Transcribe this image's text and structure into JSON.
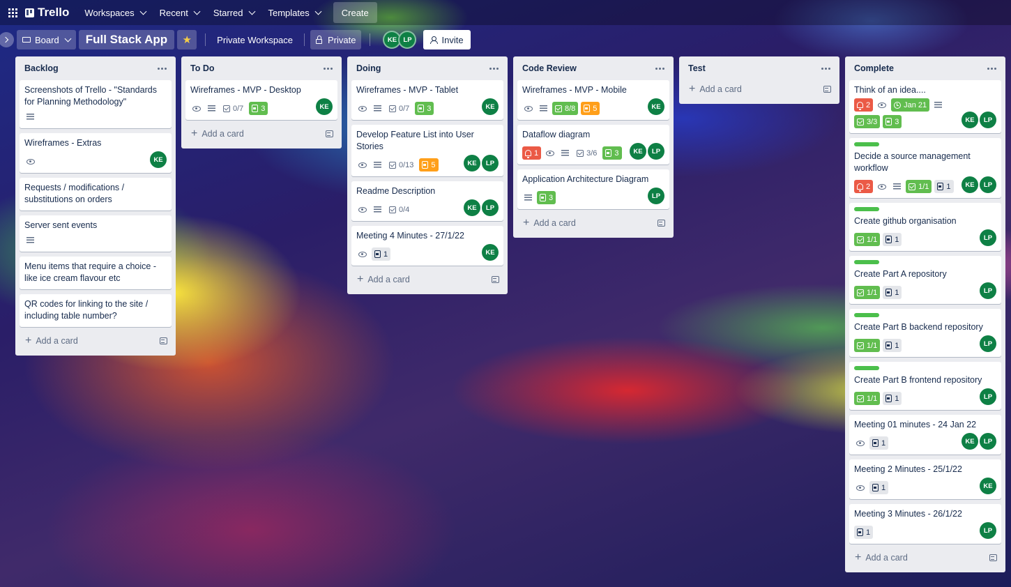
{
  "topbar": {
    "logo": "Trello",
    "nav": [
      {
        "label": "Workspaces"
      },
      {
        "label": "Recent"
      },
      {
        "label": "Starred"
      },
      {
        "label": "Templates"
      }
    ],
    "create": "Create"
  },
  "boardbar": {
    "view": "Board",
    "title": "Full Stack App",
    "workspace": "Private Workspace",
    "visibility": "Private",
    "members": [
      "KE",
      "LP"
    ],
    "invite": "Invite"
  },
  "add_card_label": "Add a card",
  "lists": [
    {
      "title": "Backlog",
      "cards": [
        {
          "title": "Screenshots of Trello - \"Standards for Planning Methodology\"",
          "badges": [
            {
              "type": "desc"
            }
          ],
          "members": []
        },
        {
          "title": "Wireframes - Extras",
          "badges": [
            {
              "type": "watch"
            }
          ],
          "members": [
            "KE"
          ]
        },
        {
          "title": "Requests / modifications / substitutions on orders",
          "badges": [],
          "members": []
        },
        {
          "title": "Server sent events",
          "badges": [
            {
              "type": "desc"
            }
          ],
          "members": []
        },
        {
          "title": "Menu items that require a choice - like ice cream flavour etc",
          "badges": [],
          "members": []
        },
        {
          "title": "QR codes for linking to the site / including table number?",
          "badges": [],
          "members": []
        }
      ]
    },
    {
      "title": "To Do",
      "cards": [
        {
          "title": "Wireframes - MVP - Desktop",
          "badges": [
            {
              "type": "watch"
            },
            {
              "type": "desc"
            },
            {
              "type": "check",
              "text": "0/7"
            },
            {
              "type": "sticker",
              "color": "green",
              "text": "3"
            }
          ],
          "members": [
            "KE"
          ]
        }
      ]
    },
    {
      "title": "Doing",
      "cards": [
        {
          "title": "Wireframes - MVP - Tablet",
          "badges": [
            {
              "type": "watch"
            },
            {
              "type": "desc"
            },
            {
              "type": "check",
              "text": "0/7"
            },
            {
              "type": "sticker",
              "color": "green",
              "text": "3"
            }
          ],
          "members": [
            "KE"
          ]
        },
        {
          "title": "Develop Feature List into User Stories",
          "badges": [
            {
              "type": "watch"
            },
            {
              "type": "desc"
            },
            {
              "type": "check",
              "text": "0/13"
            },
            {
              "type": "sticker",
              "color": "orange",
              "text": "5"
            }
          ],
          "members": [
            "KE",
            "LP"
          ]
        },
        {
          "title": "Readme Description",
          "badges": [
            {
              "type": "watch"
            },
            {
              "type": "desc"
            },
            {
              "type": "check",
              "text": "0/4"
            }
          ],
          "members": [
            "KE",
            "LP"
          ]
        },
        {
          "title": "Meeting 4 Minutes - 27/1/22",
          "badges": [
            {
              "type": "watch"
            },
            {
              "type": "sticker",
              "color": "grey",
              "text": "1"
            }
          ],
          "members": [
            "KE"
          ]
        }
      ]
    },
    {
      "title": "Code Review",
      "cards": [
        {
          "title": "Wireframes - MVP - Mobile",
          "badges": [
            {
              "type": "watch"
            },
            {
              "type": "desc"
            },
            {
              "type": "check",
              "color": "green",
              "text": "8/8"
            },
            {
              "type": "sticker",
              "color": "orange",
              "text": "5"
            }
          ],
          "members": [
            "KE"
          ]
        },
        {
          "title": "Dataflow diagram",
          "badges": [
            {
              "type": "bell",
              "color": "red",
              "text": "1"
            },
            {
              "type": "watch"
            },
            {
              "type": "desc"
            },
            {
              "type": "check",
              "text": "3/6"
            },
            {
              "type": "sticker",
              "color": "green",
              "text": "3"
            }
          ],
          "members": [
            "KE",
            "LP"
          ]
        },
        {
          "title": "Application Architecture Diagram",
          "badges": [
            {
              "type": "desc"
            },
            {
              "type": "sticker",
              "color": "green",
              "text": "3"
            }
          ],
          "members": [
            "LP"
          ]
        }
      ]
    },
    {
      "title": "Test",
      "cards": []
    },
    {
      "title": "Complete",
      "cards": [
        {
          "title": "Think of an idea....",
          "label": false,
          "badges": [
            {
              "type": "bell",
              "color": "red",
              "text": "2"
            },
            {
              "type": "watch"
            },
            {
              "type": "due",
              "color": "green",
              "text": "Jan 21"
            },
            {
              "type": "desc"
            },
            {
              "type": "check",
              "color": "green",
              "text": "3/3"
            },
            {
              "type": "sticker",
              "color": "green",
              "text": "3"
            }
          ],
          "members": [
            "KE",
            "LP"
          ]
        },
        {
          "title": "Decide a source management workflow",
          "label": true,
          "badges": [
            {
              "type": "bell",
              "color": "red",
              "text": "2"
            },
            {
              "type": "watch"
            },
            {
              "type": "desc"
            },
            {
              "type": "check",
              "color": "green",
              "text": "1/1"
            },
            {
              "type": "sticker",
              "color": "grey",
              "text": "1"
            }
          ],
          "members": [
            "KE",
            "LP"
          ]
        },
        {
          "title": "Create github organisation",
          "label": true,
          "badges": [
            {
              "type": "check",
              "color": "green",
              "text": "1/1"
            },
            {
              "type": "sticker",
              "color": "grey",
              "text": "1"
            }
          ],
          "members": [
            "LP"
          ]
        },
        {
          "title": "Create Part A repository",
          "label": true,
          "badges": [
            {
              "type": "check",
              "color": "green",
              "text": "1/1"
            },
            {
              "type": "sticker",
              "color": "grey",
              "text": "1"
            }
          ],
          "members": [
            "LP"
          ]
        },
        {
          "title": "Create Part B backend repository",
          "label": true,
          "badges": [
            {
              "type": "check",
              "color": "green",
              "text": "1/1"
            },
            {
              "type": "sticker",
              "color": "grey",
              "text": "1"
            }
          ],
          "members": [
            "LP"
          ]
        },
        {
          "title": "Create Part B frontend repository",
          "label": true,
          "badges": [
            {
              "type": "check",
              "color": "green",
              "text": "1/1"
            },
            {
              "type": "sticker",
              "color": "grey",
              "text": "1"
            }
          ],
          "members": [
            "LP"
          ]
        },
        {
          "title": "Meeting 01 minutes - 24 Jan 22",
          "label": false,
          "badges": [
            {
              "type": "watch"
            },
            {
              "type": "sticker",
              "color": "grey",
              "text": "1"
            }
          ],
          "members": [
            "KE",
            "LP"
          ]
        },
        {
          "title": "Meeting 2 Minutes - 25/1/22",
          "label": false,
          "badges": [
            {
              "type": "watch"
            },
            {
              "type": "sticker",
              "color": "grey",
              "text": "1"
            }
          ],
          "members": [
            "KE"
          ]
        },
        {
          "title": "Meeting 3 Minutes - 26/1/22",
          "label": false,
          "badges": [
            {
              "type": "sticker",
              "color": "grey",
              "text": "1"
            }
          ],
          "members": [
            "LP"
          ]
        }
      ]
    }
  ]
}
